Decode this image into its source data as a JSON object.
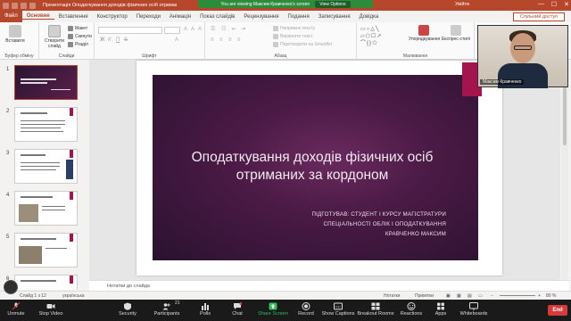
{
  "titlebar": {
    "doc_title": "Презентація Оподаткування доходів фізичних осіб отриманих за ко...",
    "sign_in": "Увійти",
    "win_min": "—",
    "win_max": "☐",
    "win_close": "✕"
  },
  "zoom_banner": {
    "text": "You are viewing Максим Кравченко's screen",
    "view_options": "View Options"
  },
  "ribbon_tabs": [
    "Файл",
    "Основне",
    "Вставлення",
    "Конструктор",
    "Переходи",
    "Анімація",
    "Показ слайдів",
    "Рецензування",
    "Подання",
    "Записування",
    "Довідка"
  ],
  "share_button": "Спільний доступ",
  "ribbon": {
    "clipboard": {
      "paste": "Вставити",
      "label": "Буфер обміну"
    },
    "slides": {
      "new_slide": "Створити слайд",
      "layout": "Макет",
      "reset": "Скинути",
      "section": "Розділ",
      "label": "Слайди"
    },
    "font": {
      "label": "Шрифт",
      "bold": "Ж",
      "italic": "К",
      "underline": "П",
      "strike": "S"
    },
    "paragraph": {
      "label": "Абзац",
      "text_direction": "Напрямок тексту",
      "align_text": "Вирівняти текст",
      "smartart": "Перетворити на SmartArt"
    },
    "drawing": {
      "label": "Малювання",
      "arrange": "Упорядкування",
      "quick_styles": "Експрес-стилі"
    }
  },
  "thumbnails": [
    {
      "num": "1",
      "style": "dark"
    },
    {
      "num": "2",
      "style": "light"
    },
    {
      "num": "3",
      "style": "light"
    },
    {
      "num": "4",
      "style": "light"
    },
    {
      "num": "5",
      "style": "light"
    },
    {
      "num": "6",
      "style": "light"
    }
  ],
  "slide": {
    "title_line1": "Оподаткування доходів фізичних осіб",
    "title_line2": "отриманих за кордоном",
    "sub_line1": "ПІДГОТУВАВ: СТУДЕНТ І КУРСУ МАГІСТРАТУРИ",
    "sub_line2": "СПЕЦІАЛЬНОСТІ ОБЛІК І ОПОДАТКУВАННЯ",
    "sub_line3": "КРАВЧЕНКО МАКСИМ"
  },
  "notes_placeholder": "Нотатки до слайда",
  "statusbar": {
    "slide_count": "Слайд 1 з 12",
    "language": "українська",
    "notes": "Нотатки",
    "comments": "Примітки",
    "zoom": "80 %"
  },
  "webcam": {
    "name": "Максим Кравченко"
  },
  "zoom_toolbar": {
    "unmute": "Unmute",
    "stop_video": "Stop Video",
    "security": "Security",
    "participants": "Participants",
    "participants_count": "21",
    "polls": "Polls",
    "chat": "Chat",
    "share_screen": "Share Screen",
    "record": "Record",
    "show_captions": "Show Captions",
    "breakout_rooms": "Breakout Rooms",
    "reactions": "Reactions",
    "apps": "Apps",
    "whiteboards": "Whiteboards",
    "end": "End"
  },
  "colors": {
    "accent": "#b7472a",
    "slide_accent": "#a4144d",
    "share_green": "#2d8c3c",
    "end_red": "#d63a3a"
  }
}
